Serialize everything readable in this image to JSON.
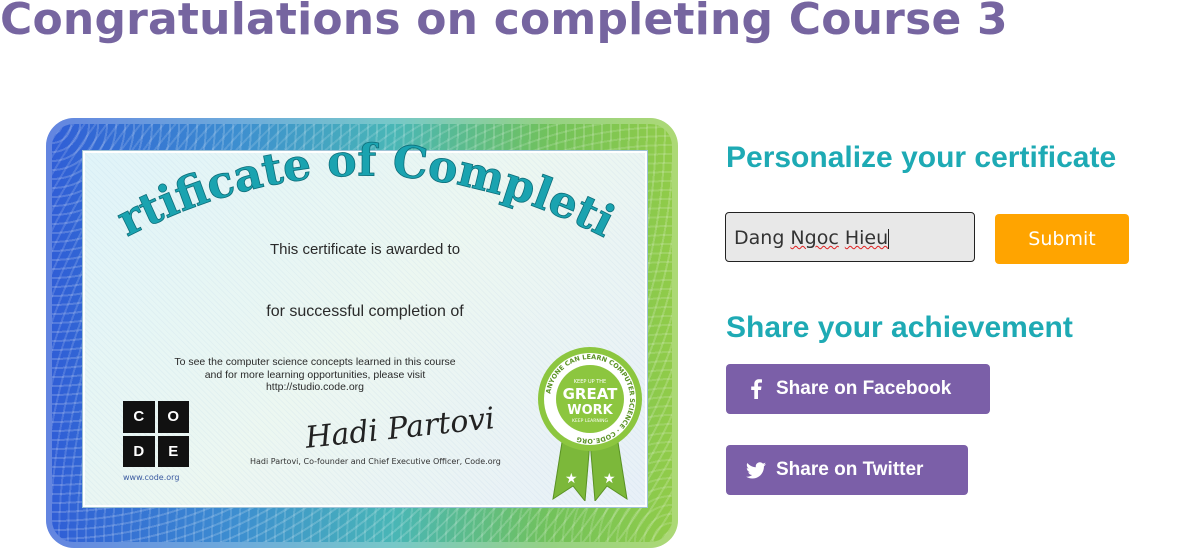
{
  "page": {
    "title": "Congratulations on completing Course 3"
  },
  "certificate": {
    "heading": "Certificate of Completion",
    "awarded_text": "This certificate is awarded to",
    "completion_text": "for successful completion of",
    "fineprint": [
      "To see the computer science concepts learned in this course",
      "and for more learning opportunities, please visit",
      "http://studio.code.org"
    ],
    "logo_letters": [
      "C",
      "O",
      "D",
      "E"
    ],
    "logo_url": "www.code.org",
    "signature": "Hadi Partovi",
    "signature_caption": "Hadi Partovi, Co-founder and Chief Executive Officer, Code.org",
    "badge": {
      "line1": "GREAT",
      "line2": "WORK",
      "top": "KEEP UP THE",
      "bottom": "KEEP LEARNING",
      "ring": "ANYONE CAN LEARN COMPUTER SCIENCE · CODE.ORG"
    }
  },
  "personalize": {
    "title": "Personalize your certificate",
    "name_parts": [
      "Dang ",
      "Ngoc",
      " ",
      "Hieu"
    ],
    "submit_label": "Submit"
  },
  "share": {
    "title": "Share your achievement",
    "facebook_label": "Share on Facebook",
    "twitter_label": "Share on Twitter"
  },
  "colors": {
    "title": "#7665a0",
    "accent": "#1eaab4",
    "submit": "#ffa400",
    "share": "#7b5fa8"
  }
}
